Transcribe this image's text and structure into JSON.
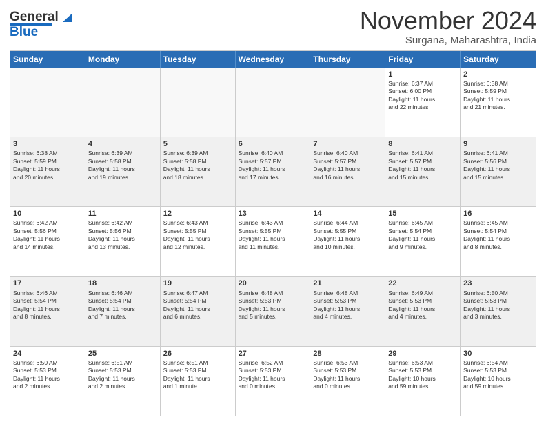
{
  "logo": {
    "line1": "General",
    "line2": "Blue"
  },
  "title": "November 2024",
  "location": "Surgana, Maharashtra, India",
  "calendar": {
    "headers": [
      "Sunday",
      "Monday",
      "Tuesday",
      "Wednesday",
      "Thursday",
      "Friday",
      "Saturday"
    ],
    "rows": [
      [
        {
          "day": "",
          "text": "",
          "empty": true
        },
        {
          "day": "",
          "text": "",
          "empty": true
        },
        {
          "day": "",
          "text": "",
          "empty": true
        },
        {
          "day": "",
          "text": "",
          "empty": true
        },
        {
          "day": "",
          "text": "",
          "empty": true
        },
        {
          "day": "1",
          "text": "Sunrise: 6:37 AM\nSunset: 6:00 PM\nDaylight: 11 hours\nand 22 minutes.",
          "empty": false
        },
        {
          "day": "2",
          "text": "Sunrise: 6:38 AM\nSunset: 5:59 PM\nDaylight: 11 hours\nand 21 minutes.",
          "empty": false
        }
      ],
      [
        {
          "day": "3",
          "text": "Sunrise: 6:38 AM\nSunset: 5:59 PM\nDaylight: 11 hours\nand 20 minutes.",
          "empty": false
        },
        {
          "day": "4",
          "text": "Sunrise: 6:39 AM\nSunset: 5:58 PM\nDaylight: 11 hours\nand 19 minutes.",
          "empty": false
        },
        {
          "day": "5",
          "text": "Sunrise: 6:39 AM\nSunset: 5:58 PM\nDaylight: 11 hours\nand 18 minutes.",
          "empty": false
        },
        {
          "day": "6",
          "text": "Sunrise: 6:40 AM\nSunset: 5:57 PM\nDaylight: 11 hours\nand 17 minutes.",
          "empty": false
        },
        {
          "day": "7",
          "text": "Sunrise: 6:40 AM\nSunset: 5:57 PM\nDaylight: 11 hours\nand 16 minutes.",
          "empty": false
        },
        {
          "day": "8",
          "text": "Sunrise: 6:41 AM\nSunset: 5:57 PM\nDaylight: 11 hours\nand 15 minutes.",
          "empty": false
        },
        {
          "day": "9",
          "text": "Sunrise: 6:41 AM\nSunset: 5:56 PM\nDaylight: 11 hours\nand 15 minutes.",
          "empty": false
        }
      ],
      [
        {
          "day": "10",
          "text": "Sunrise: 6:42 AM\nSunset: 5:56 PM\nDaylight: 11 hours\nand 14 minutes.",
          "empty": false
        },
        {
          "day": "11",
          "text": "Sunrise: 6:42 AM\nSunset: 5:56 PM\nDaylight: 11 hours\nand 13 minutes.",
          "empty": false
        },
        {
          "day": "12",
          "text": "Sunrise: 6:43 AM\nSunset: 5:55 PM\nDaylight: 11 hours\nand 12 minutes.",
          "empty": false
        },
        {
          "day": "13",
          "text": "Sunrise: 6:43 AM\nSunset: 5:55 PM\nDaylight: 11 hours\nand 11 minutes.",
          "empty": false
        },
        {
          "day": "14",
          "text": "Sunrise: 6:44 AM\nSunset: 5:55 PM\nDaylight: 11 hours\nand 10 minutes.",
          "empty": false
        },
        {
          "day": "15",
          "text": "Sunrise: 6:45 AM\nSunset: 5:54 PM\nDaylight: 11 hours\nand 9 minutes.",
          "empty": false
        },
        {
          "day": "16",
          "text": "Sunrise: 6:45 AM\nSunset: 5:54 PM\nDaylight: 11 hours\nand 8 minutes.",
          "empty": false
        }
      ],
      [
        {
          "day": "17",
          "text": "Sunrise: 6:46 AM\nSunset: 5:54 PM\nDaylight: 11 hours\nand 8 minutes.",
          "empty": false
        },
        {
          "day": "18",
          "text": "Sunrise: 6:46 AM\nSunset: 5:54 PM\nDaylight: 11 hours\nand 7 minutes.",
          "empty": false
        },
        {
          "day": "19",
          "text": "Sunrise: 6:47 AM\nSunset: 5:54 PM\nDaylight: 11 hours\nand 6 minutes.",
          "empty": false
        },
        {
          "day": "20",
          "text": "Sunrise: 6:48 AM\nSunset: 5:53 PM\nDaylight: 11 hours\nand 5 minutes.",
          "empty": false
        },
        {
          "day": "21",
          "text": "Sunrise: 6:48 AM\nSunset: 5:53 PM\nDaylight: 11 hours\nand 4 minutes.",
          "empty": false
        },
        {
          "day": "22",
          "text": "Sunrise: 6:49 AM\nSunset: 5:53 PM\nDaylight: 11 hours\nand 4 minutes.",
          "empty": false
        },
        {
          "day": "23",
          "text": "Sunrise: 6:50 AM\nSunset: 5:53 PM\nDaylight: 11 hours\nand 3 minutes.",
          "empty": false
        }
      ],
      [
        {
          "day": "24",
          "text": "Sunrise: 6:50 AM\nSunset: 5:53 PM\nDaylight: 11 hours\nand 2 minutes.",
          "empty": false
        },
        {
          "day": "25",
          "text": "Sunrise: 6:51 AM\nSunset: 5:53 PM\nDaylight: 11 hours\nand 2 minutes.",
          "empty": false
        },
        {
          "day": "26",
          "text": "Sunrise: 6:51 AM\nSunset: 5:53 PM\nDaylight: 11 hours\nand 1 minute.",
          "empty": false
        },
        {
          "day": "27",
          "text": "Sunrise: 6:52 AM\nSunset: 5:53 PM\nDaylight: 11 hours\nand 0 minutes.",
          "empty": false
        },
        {
          "day": "28",
          "text": "Sunrise: 6:53 AM\nSunset: 5:53 PM\nDaylight: 11 hours\nand 0 minutes.",
          "empty": false
        },
        {
          "day": "29",
          "text": "Sunrise: 6:53 AM\nSunset: 5:53 PM\nDaylight: 10 hours\nand 59 minutes.",
          "empty": false
        },
        {
          "day": "30",
          "text": "Sunrise: 6:54 AM\nSunset: 5:53 PM\nDaylight: 10 hours\nand 59 minutes.",
          "empty": false
        }
      ]
    ]
  }
}
